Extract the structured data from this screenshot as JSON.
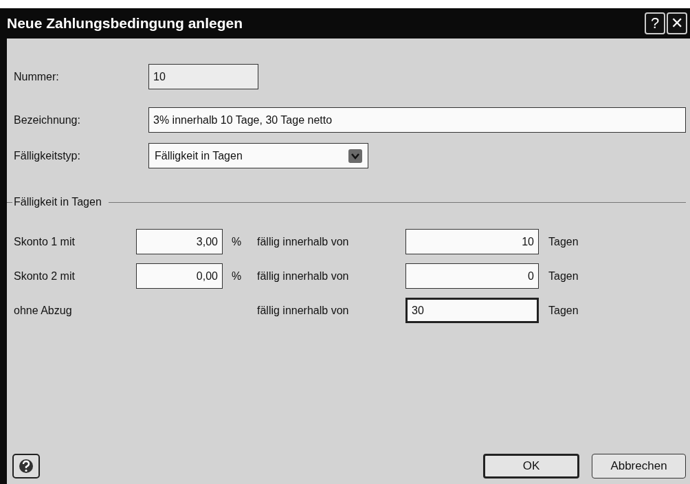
{
  "window": {
    "title": "Neue Zahlungsbedingung anlegen",
    "title_buttons": [
      "?",
      "✕"
    ]
  },
  "fields": {
    "nummer": {
      "label": "Nummer:",
      "value": "10"
    },
    "bezeichnung": {
      "label": "Bezeichnung:",
      "value": "3% innerhalb 10 Tage, 30 Tage netto"
    },
    "faelligkeitstyp": {
      "label": "Fälligkeitstyp:",
      "value": "Fälligkeit in Tagen"
    }
  },
  "group": {
    "title": "Fälligkeit in Tagen",
    "rows": [
      {
        "label": "Skonto 1 mit",
        "percent": "3,00",
        "percent_unit": "%",
        "due_label": "fällig innerhalb von",
        "days": "10",
        "days_unit": "Tagen",
        "focused": false
      },
      {
        "label": "Skonto 2 mit",
        "percent": "0,00",
        "percent_unit": "%",
        "due_label": "fällig innerhalb von",
        "days": "0",
        "days_unit": "Tagen",
        "focused": false
      },
      {
        "label": "ohne Abzug",
        "due_label": "fällig innerhalb von",
        "days": "30",
        "days_unit": "Tagen",
        "focused": true
      }
    ]
  },
  "buttons": [
    {
      "label": "OK",
      "default": true
    },
    {
      "label": "Abbrechen",
      "default": false
    }
  ]
}
